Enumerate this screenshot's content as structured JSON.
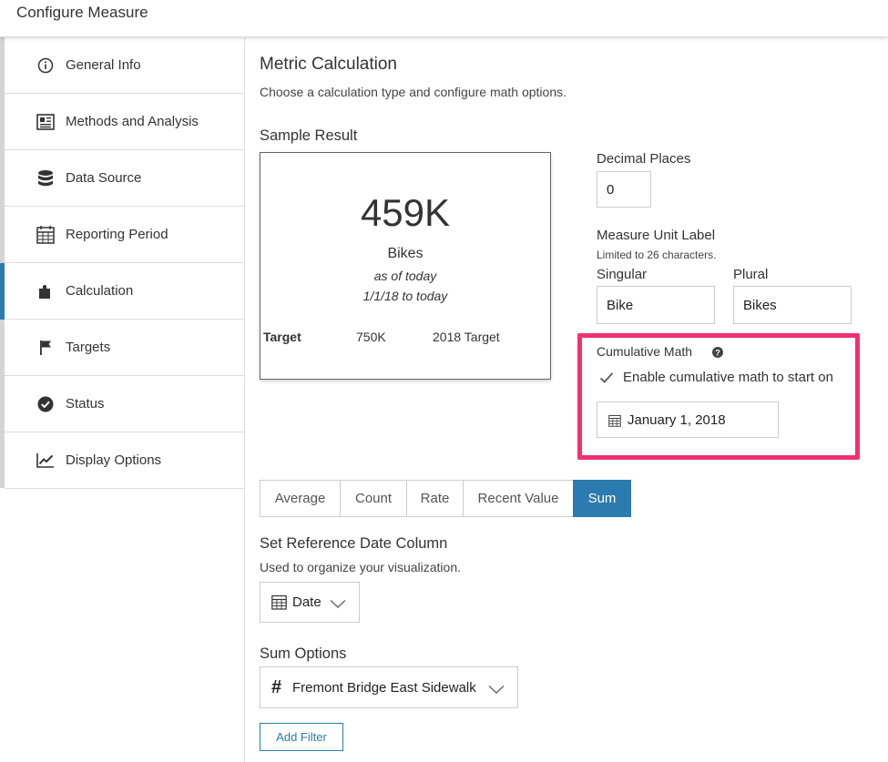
{
  "header": {
    "title": "Configure Measure"
  },
  "sidebar": {
    "items": [
      {
        "label": "General Info",
        "icon": "info-icon"
      },
      {
        "label": "Methods and Analysis",
        "icon": "document-icon"
      },
      {
        "label": "Data Source",
        "icon": "database-icon"
      },
      {
        "label": "Reporting Period",
        "icon": "calendar-icon"
      },
      {
        "label": "Calculation",
        "icon": "puzzle-icon",
        "active": true
      },
      {
        "label": "Targets",
        "icon": "flag-icon"
      },
      {
        "label": "Status",
        "icon": "check-circle-icon"
      },
      {
        "label": "Display Options",
        "icon": "line-chart-icon"
      }
    ]
  },
  "main": {
    "title": "Metric Calculation",
    "subtitle": "Choose a calculation type and configure math options.",
    "sample": {
      "heading": "Sample Result",
      "value": "459K",
      "unit": "Bikes",
      "as_of": "as of today",
      "range": "1/1/18 to today",
      "target_label": "Target",
      "target_value": "750K",
      "target_name": "2018 Target"
    },
    "decimal_places": {
      "label": "Decimal Places",
      "value": "0"
    },
    "unit_label": {
      "label": "Measure Unit Label",
      "hint": "Limited to 26 characters.",
      "singular_label": "Singular",
      "singular_value": "Bike",
      "plural_label": "Plural",
      "plural_value": "Bikes"
    },
    "cumulative": {
      "label": "Cumulative Math",
      "checkbox_label": "Enable cumulative math to start on",
      "checked": true,
      "date": "January 1, 2018"
    },
    "calc_types": [
      "Average",
      "Count",
      "Rate",
      "Recent Value",
      "Sum"
    ],
    "active_calc_type": "Sum",
    "reference_date": {
      "heading": "Set Reference Date Column",
      "hint": "Used to organize your visualization.",
      "value": "Date"
    },
    "sum_options": {
      "heading": "Sum Options",
      "column": "Fremont Bridge East Sidewalk"
    },
    "add_filter_label": "Add Filter"
  },
  "colors": {
    "accent": "#2b7bb0",
    "highlight": "#f0306f",
    "border": "#cccccc"
  }
}
